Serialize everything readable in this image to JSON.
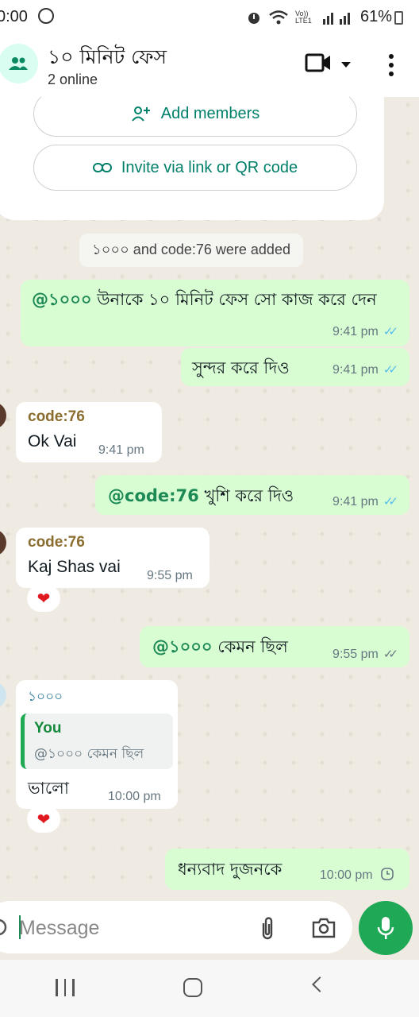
{
  "status_bar": {
    "time": "0:00",
    "network": "Vo)) LTE1",
    "battery": "61%",
    "icons": [
      "whatsapp-icon",
      "alarm-icon",
      "wifi-icon",
      "signal-icon",
      "battery-icon"
    ]
  },
  "header": {
    "title": "১০ মিনিট ফেস",
    "subtitle": "2 online",
    "icons": [
      "group-avatar-icon",
      "video-call-icon",
      "dropdown-caret-icon",
      "more-options-icon"
    ]
  },
  "group_actions": {
    "add_members": "Add members",
    "invite": "Invite via link or QR code"
  },
  "system_message": "১০০০ and code:76 were added",
  "messages": [
    {
      "dir": "out",
      "mention": "@১০০০",
      "text": " উনাকে ১০ মিনিট ফেস সো কাজ করে দেন",
      "time": "9:41 pm",
      "status": "read"
    },
    {
      "dir": "out",
      "mention": "",
      "text": "সুন্দর করে দিও",
      "time": "9:41 pm",
      "status": "read"
    },
    {
      "dir": "in",
      "sender": "code:76",
      "text": "Ok Vai",
      "time": "9:41 pm"
    },
    {
      "dir": "out",
      "mention": "@code:76",
      "text": " খুশি করে দিও",
      "time": "9:41 pm",
      "status": "read"
    },
    {
      "dir": "in",
      "sender": "code:76",
      "text": "Kaj Shas vai",
      "time": "9:55 pm",
      "reaction": "❤"
    },
    {
      "dir": "out",
      "mention": "@১০০০",
      "text": " কেমন ছিল",
      "time": "9:55 pm",
      "status": "delivered"
    },
    {
      "dir": "in",
      "sender": "১০০০",
      "quote_name": "You",
      "quote_text": "@১০০০ কেমন ছিল",
      "text": "ভালো",
      "time": "10:00 pm",
      "reaction": "❤"
    },
    {
      "dir": "out",
      "mention": "",
      "text": "ধন্যবাদ দুজনকে",
      "time": "10:00 pm",
      "status": "pending"
    }
  ],
  "input": {
    "placeholder": "Message",
    "icons": [
      "emoji-icon",
      "attach-icon",
      "camera-icon",
      "mic-icon"
    ]
  },
  "colors": {
    "outgoing_bubble": "#d9fdd3",
    "incoming_bubble": "#ffffff",
    "accent_green": "#1fa855",
    "read_ticks": "#53bdeb",
    "chat_background": "#efeae2"
  }
}
